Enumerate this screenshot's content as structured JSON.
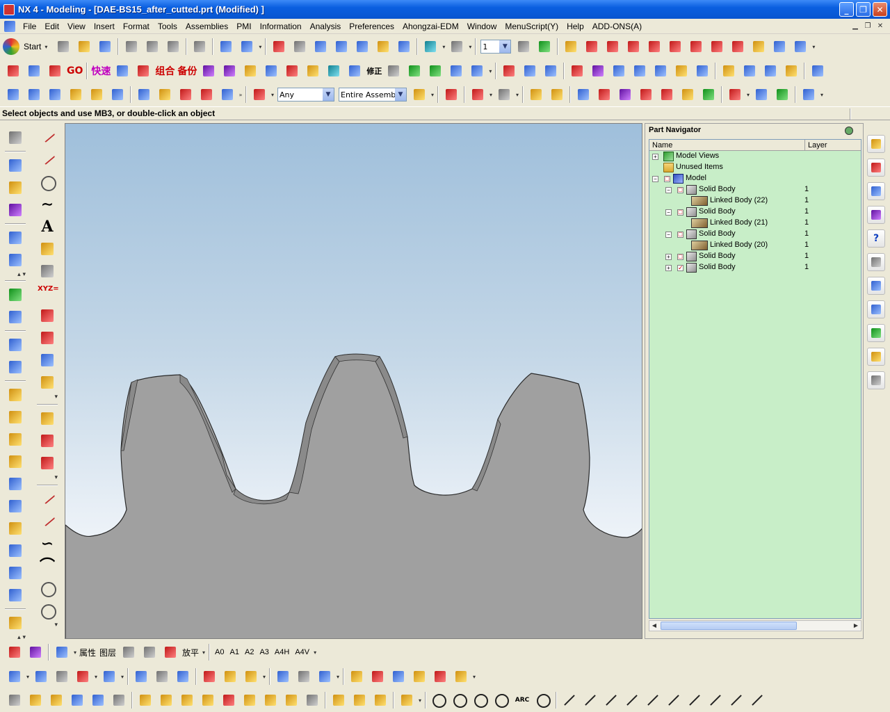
{
  "window": {
    "title": "NX 4 - Modeling - [DAE-BS15_after_cutted.prt (Modified) ]",
    "minimize": "_",
    "maximize": "❐",
    "close": "✕"
  },
  "menubar": {
    "items": [
      "File",
      "Edit",
      "View",
      "Insert",
      "Format",
      "Tools",
      "Assemblies",
      "PMI",
      "Information",
      "Analysis",
      "Preferences",
      "Ahongzai-EDM",
      "Window",
      "MenuScript(Y)",
      "Help",
      "ADD-ONS(A)"
    ]
  },
  "toolbar1": {
    "start_label": "Start",
    "layer_value": "1"
  },
  "toolbar2": {
    "label_go": "GO",
    "label_quick": "快速",
    "label_combine": "组合",
    "label_backup": "备份",
    "label_modify": "修正"
  },
  "toolbar3": {
    "type_filter": "Any",
    "scope_filter": "Entire Assembly"
  },
  "status": {
    "prompt": "Select objects and use MB3, or double-click an object"
  },
  "left_toolbar": {
    "text_tool": "A",
    "xyz_label": "XYZ="
  },
  "part_navigator": {
    "title": "Part Navigator",
    "columns": {
      "name": "Name",
      "layer": "Layer"
    },
    "rows": [
      {
        "label": "Model Views",
        "layer": "",
        "level": 0,
        "expander": "+",
        "check": "",
        "icon": "views"
      },
      {
        "label": "Unused Items",
        "layer": "",
        "level": 0,
        "expander": "",
        "check": "",
        "icon": "folder"
      },
      {
        "label": "Model",
        "layer": "",
        "level": 0,
        "expander": "−",
        "check": "□",
        "icon": "model"
      },
      {
        "label": "Solid Body",
        "layer": "1",
        "level": 1,
        "expander": "−",
        "check": "□",
        "icon": "solid"
      },
      {
        "label": "Linked Body (22)",
        "layer": "1",
        "level": 2,
        "expander": "",
        "check": "",
        "icon": "linked"
      },
      {
        "label": "Solid Body",
        "layer": "1",
        "level": 1,
        "expander": "−",
        "check": "□",
        "icon": "solid"
      },
      {
        "label": "Linked Body (21)",
        "layer": "1",
        "level": 2,
        "expander": "",
        "check": "",
        "icon": "linked"
      },
      {
        "label": "Solid Body",
        "layer": "1",
        "level": 1,
        "expander": "−",
        "check": "□",
        "icon": "solid"
      },
      {
        "label": "Linked Body (20)",
        "layer": "1",
        "level": 2,
        "expander": "",
        "check": "",
        "icon": "linked"
      },
      {
        "label": "Solid Body",
        "layer": "1",
        "level": 1,
        "expander": "+",
        "check": "□",
        "icon": "solid"
      },
      {
        "label": "Solid Body",
        "layer": "1",
        "level": 1,
        "expander": "+",
        "check": "✓",
        "icon": "solid"
      }
    ]
  },
  "resource_bar": {
    "help_label": "?"
  },
  "bottom_toolbar1": {
    "attr_label": "属性",
    "layer_label": "图层",
    "flatten_label": "放平",
    "sheets": [
      "A0",
      "A1",
      "A2",
      "A3",
      "A4H",
      "A4V"
    ]
  },
  "bottom_toolbar3": {
    "arc_label": "ARC"
  },
  "colors": {
    "title_bar": "#0a5fe0",
    "viewport_top": "#9fbfdb",
    "part_fill": "#a0a0a0",
    "navigator_bg": "#c8eec8"
  }
}
